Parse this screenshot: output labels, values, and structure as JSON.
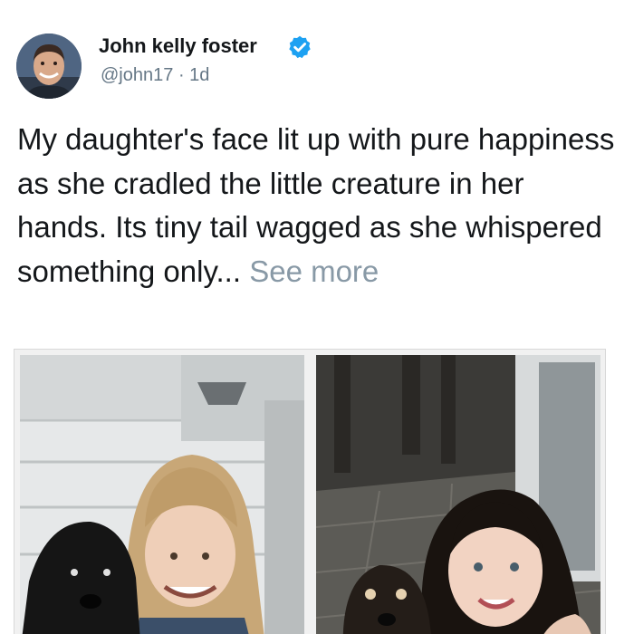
{
  "author": {
    "name": "John kelly foster",
    "handle": "@john17",
    "separator": "·",
    "time": "1d",
    "verified": true,
    "avatar_icon": "profile-photo-man"
  },
  "tweet": {
    "text": "My daughter's face lit up with pure happiness as she cradled the little creature in her hands. Its tiny tail wagged as she whispered something only...",
    "see_more_label": "See more"
  },
  "media": {
    "photos": [
      {
        "description_icon": "photo-girl-with-dog-young"
      },
      {
        "description_icon": "photo-woman-with-dog-adult"
      }
    ]
  },
  "colors": {
    "text_primary": "#14171a",
    "text_secondary": "#657786",
    "see_more": "#8899a6",
    "verified_blue": "#1da1f2"
  }
}
